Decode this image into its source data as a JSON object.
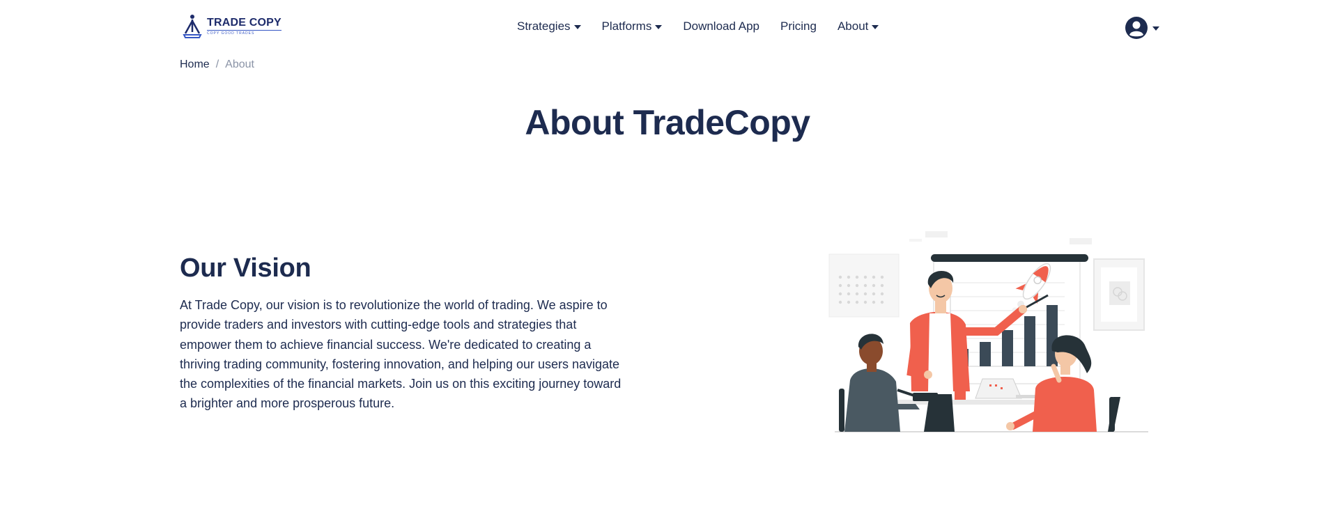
{
  "brand": {
    "name": "TRADE COPY",
    "tagline": "COPY GOOD TRADES"
  },
  "nav": {
    "items": [
      {
        "label": "Strategies",
        "dropdown": true
      },
      {
        "label": "Platforms",
        "dropdown": true
      },
      {
        "label": "Download App",
        "dropdown": false
      },
      {
        "label": "Pricing",
        "dropdown": false
      },
      {
        "label": "About",
        "dropdown": true
      }
    ],
    "account_icon": "user-circle-icon"
  },
  "breadcrumb": {
    "home": "Home",
    "separator": "/",
    "current": "About"
  },
  "page": {
    "title": "About TradeCopy"
  },
  "vision": {
    "title": "Our Vision",
    "text": "At Trade Copy, our vision is to revolutionize the world of trading. We aspire to provide traders and investors with cutting-edge tools and strategies that empower them to achieve financial success. We're dedicated to creating a thriving trading community, fostering innovation, and helping our users navigate the complexities of the financial markets. Join us on this exciting journey toward a brighter and more prosperous future."
  },
  "colors": {
    "primary_text": "#1d2b4f",
    "brand_blue": "#1d2b6b",
    "accent_coral": "#f0604d",
    "muted": "#8a93a6",
    "chart_bar": "#3b4a57"
  }
}
